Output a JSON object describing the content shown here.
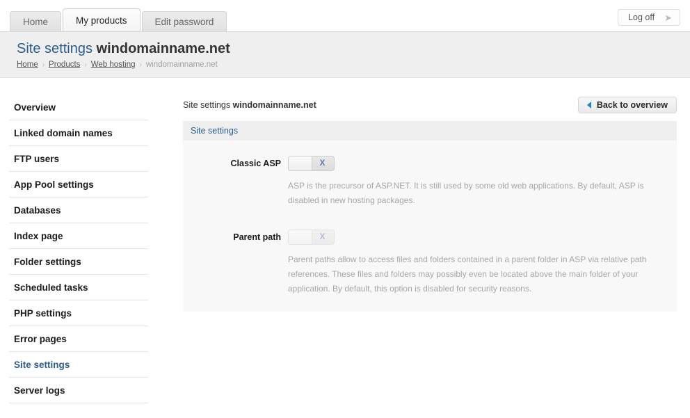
{
  "topbar": {
    "tabs": [
      {
        "label": "Home",
        "active": false
      },
      {
        "label": "My products",
        "active": true
      },
      {
        "label": "Edit password",
        "active": false
      }
    ],
    "logoff_label": "Log off",
    "logoff_icon": "arrow-right-icon"
  },
  "pagehead": {
    "title_prefix": "Site settings",
    "title_domain": "windomainname.net",
    "breadcrumb": [
      {
        "label": "Home",
        "link": true
      },
      {
        "label": "Products",
        "link": true
      },
      {
        "label": "Web hosting",
        "link": true
      },
      {
        "label": "windomainname.net",
        "link": false
      }
    ],
    "separator": "›"
  },
  "sidebar": {
    "items": [
      {
        "label": "Overview",
        "active": false
      },
      {
        "label": "Linked domain names",
        "active": false
      },
      {
        "label": "FTP users",
        "active": false
      },
      {
        "label": "App Pool settings",
        "active": false
      },
      {
        "label": "Databases",
        "active": false
      },
      {
        "label": "Index page",
        "active": false
      },
      {
        "label": "Folder settings",
        "active": false
      },
      {
        "label": "Scheduled tasks",
        "active": false
      },
      {
        "label": "PHP settings",
        "active": false
      },
      {
        "label": "Error pages",
        "active": false
      },
      {
        "label": "Site settings",
        "active": true
      },
      {
        "label": "Server logs",
        "active": false
      }
    ]
  },
  "main": {
    "head_prefix": "Site settings",
    "head_domain": "windomainname.net",
    "back_button": "Back to overview",
    "back_icon": "triangle-left-icon",
    "panel_title": "Site settings",
    "fields": [
      {
        "label": "Classic ASP",
        "toggle_state": "off",
        "toggle_mark": "X",
        "disabled": false,
        "description": "ASP is the precursor of ASP.NET. It is still used by some old web applications. By default, ASP is disabled in new hosting packages."
      },
      {
        "label": "Parent path",
        "toggle_state": "off",
        "toggle_mark": "X",
        "disabled": true,
        "description": "Parent paths allow to access files and folders contained in a parent folder in ASP via relative path references. These files and folders may possibly even be located above the main folder of your application. By default, this option is disabled for security reasons."
      }
    ]
  },
  "colors": {
    "accent_blue": "#2c5d8f",
    "icon_blue": "#1f87c9",
    "header_band": "#efefef",
    "panel_body": "#f8f8f8",
    "muted_text": "#a6a6a6"
  }
}
